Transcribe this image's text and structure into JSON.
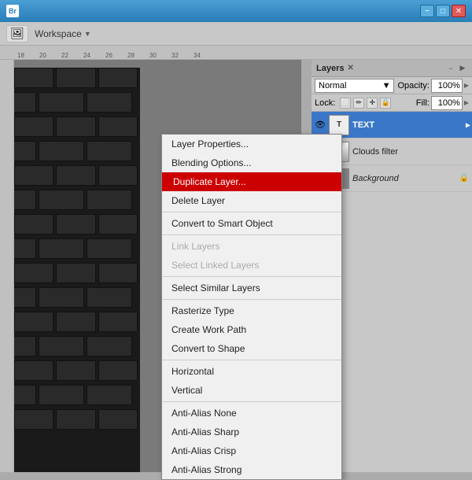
{
  "titlebar": {
    "title": "Adobe Bridge",
    "minimize_label": "−",
    "maximize_label": "□",
    "close_label": "✕"
  },
  "toolbar": {
    "workspace_label": "Workspace",
    "workspace_arrow": "▼"
  },
  "layers_panel": {
    "title": "Layers",
    "close_label": "✕",
    "blend_mode": "Normal",
    "blend_arrow": "▼",
    "opacity_label": "Opacity:",
    "opacity_value": "100%",
    "lock_label": "Lock:",
    "fill_label": "Fill:",
    "fill_value": "100%",
    "panel_arrow": "▶",
    "layers": [
      {
        "name": "TEXT",
        "type": "text",
        "selected": true,
        "thumb_label": "T"
      },
      {
        "name": "Clouds filter",
        "type": "clouds",
        "selected": false,
        "thumb_label": ""
      },
      {
        "name": "Background",
        "type": "bg",
        "selected": false,
        "thumb_label": "",
        "locked": true
      }
    ]
  },
  "context_menu": {
    "items": [
      {
        "label": "Layer Properties...",
        "enabled": true,
        "highlighted": false
      },
      {
        "label": "Blending Options...",
        "enabled": true,
        "highlighted": false
      },
      {
        "label": "Duplicate Layer...",
        "enabled": true,
        "highlighted": true
      },
      {
        "label": "Delete Layer",
        "enabled": true,
        "highlighted": false
      },
      {
        "separator_after": true
      },
      {
        "label": "Convert to Smart Object",
        "enabled": true,
        "highlighted": false
      },
      {
        "separator_after": true
      },
      {
        "label": "Link Layers",
        "enabled": false,
        "highlighted": false
      },
      {
        "label": "Select Linked Layers",
        "enabled": false,
        "highlighted": false
      },
      {
        "separator_after": true
      },
      {
        "label": "Select Similar Layers",
        "enabled": true,
        "highlighted": false
      },
      {
        "separator_after": true
      },
      {
        "label": "Rasterize Type",
        "enabled": true,
        "highlighted": false
      },
      {
        "label": "Create Work Path",
        "enabled": true,
        "highlighted": false
      },
      {
        "label": "Convert to Shape",
        "enabled": true,
        "highlighted": false
      },
      {
        "separator_after": true
      },
      {
        "label": "Horizontal",
        "enabled": true,
        "highlighted": false
      },
      {
        "label": "Vertical",
        "enabled": true,
        "highlighted": false
      },
      {
        "separator_after": true
      },
      {
        "label": "Anti-Alias None",
        "enabled": true,
        "highlighted": false
      },
      {
        "label": "Anti-Alias Sharp",
        "enabled": true,
        "highlighted": false
      },
      {
        "label": "Anti-Alias Crisp",
        "enabled": true,
        "highlighted": false
      },
      {
        "label": "Anti-Alias Strong",
        "enabled": true,
        "highlighted": false
      }
    ]
  },
  "ruler": {
    "marks": [
      "18",
      "20",
      "22",
      "24",
      "26",
      "28",
      "30",
      "32",
      "34"
    ]
  }
}
